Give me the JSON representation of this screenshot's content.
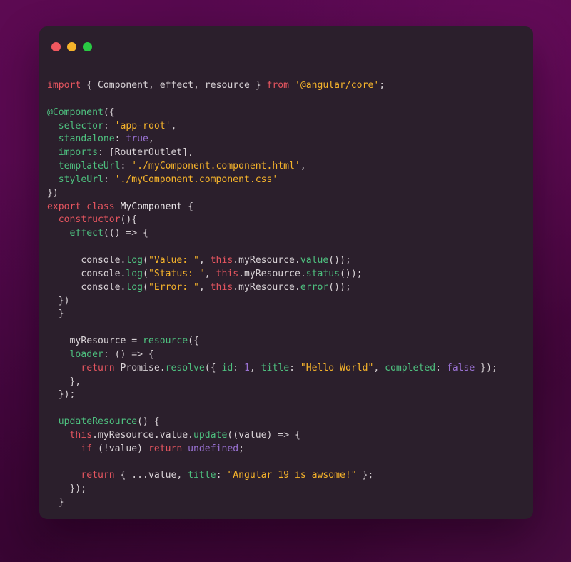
{
  "window": {
    "traffic_lights": [
      {
        "name": "close",
        "color": "#f0575f"
      },
      {
        "name": "minimize",
        "color": "#f5b32b"
      },
      {
        "name": "maximize",
        "color": "#29c943"
      }
    ],
    "background": "#2b1f2c",
    "page_background": "#4a0542"
  },
  "editor": {
    "language": "typescript",
    "font_size_px": 13,
    "code": "import { Component, effect, resource } from '@angular/core';\n\n@Component({\n  selector: 'app-root',\n  standalone: true,\n  imports: [RouterOutlet],\n  templateUrl: './myComponent.component.html',\n  styleUrl: './myComponent.component.css'\n})\nexport class MyComponent {\n  constructor(){\n    effect(() => {\n\n      console.log(\"Value: \", this.myResource.value());\n      console.log(\"Status: \", this.myResource.status());\n      console.log(\"Error: \", this.myResource.error());\n  })\n  }\n\n    myResource = resource({\n    loader: () => {\n      return Promise.resolve({ id: 1, title: \"Hello World\", completed: false });\n    },\n  });\n\n  updateResource() {\n    this.myResource.value.update((value) => {\n      if (!value) return undefined;\n\n      return { ...value, title: \"Angular 19 is awsome!\" };\n    });\n  }\n\n\n}",
    "lines": [
      "import { Component, effect, resource } from '@angular/core';",
      "",
      "@Component({",
      "  selector: 'app-root',",
      "  standalone: true,",
      "  imports: [RouterOutlet],",
      "  templateUrl: './myComponent.component.html',",
      "  styleUrl: './myComponent.component.css'",
      "})",
      "export class MyComponent {",
      "  constructor(){",
      "    effect(() => {",
      "",
      "      console.log(\"Value: \", this.myResource.value());",
      "      console.log(\"Status: \", this.myResource.status());",
      "      console.log(\"Error: \", this.myResource.error());",
      "  })",
      "  }",
      "",
      "    myResource = resource({",
      "    loader: () => {",
      "      return Promise.resolve({ id: 1, title: \"Hello World\", completed: false });",
      "    },",
      "  });",
      "",
      "  updateResource() {",
      "    this.myResource.value.update((value) => {",
      "      if (!value) return undefined;",
      "",
      "      return { ...value, title: \"Angular 19 is awsome!\" };",
      "    });",
      "  }",
      "",
      "",
      "}"
    ],
    "strings": [
      "'@angular/core'",
      "'app-root'",
      "'./myComponent.component.html'",
      "'./myComponent.component.css'",
      "\"Value: \"",
      "\"Status: \"",
      "\"Error: \"",
      "\"Hello World\"",
      "\"Angular 19 is awsome!\""
    ],
    "identifiers": [
      "Component",
      "effect",
      "resource",
      "RouterOutlet",
      "MyComponent",
      "myResource",
      "updateResource",
      "Promise",
      "console"
    ],
    "keywords": [
      "import",
      "from",
      "export",
      "class",
      "constructor",
      "return",
      "if"
    ],
    "literals": [
      "true",
      "false",
      "undefined",
      "1"
    ],
    "theme_colors": {
      "keyword": "#e5555f",
      "function": "#4ec07f",
      "string": "#f5b32b",
      "constant": "#9a72d4",
      "this": "#e5555f",
      "plain": "#d8d2d6"
    }
  }
}
